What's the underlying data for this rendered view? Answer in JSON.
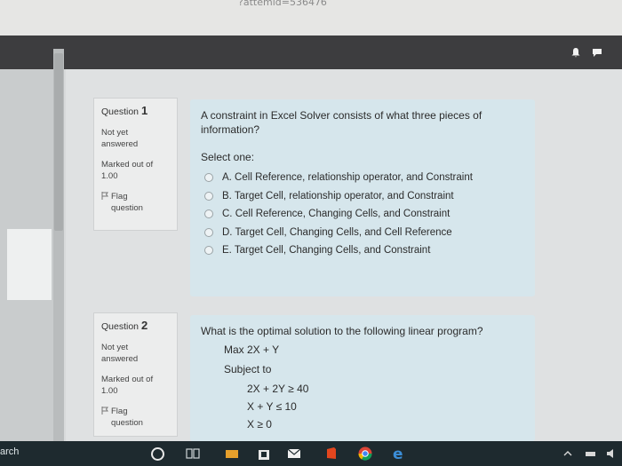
{
  "browser": {
    "url_fragment": "?attemid=536476"
  },
  "questions": [
    {
      "label": "Question",
      "number": "1",
      "status_line1": "Not yet",
      "status_line2": "answered",
      "marked_label": "Marked out of",
      "marked_value": "1.00",
      "flag_line1": "Flag",
      "flag_line2": "question",
      "prompt": "A constraint in Excel Solver consists of what three pieces of information?",
      "select_label": "Select one:",
      "options": [
        "A. Cell Reference, relationship operator, and Constraint",
        "B. Target Cell, relationship operator, and Constraint",
        "C. Cell Reference, Changing Cells, and Constraint",
        "D. Target Cell, Changing Cells, and Cell Reference",
        "E. Target Cell, Changing Cells, and Constraint"
      ]
    },
    {
      "label": "Question",
      "number": "2",
      "status_line1": "Not yet",
      "status_line2": "answered",
      "marked_label": "Marked out of",
      "marked_value": "1.00",
      "flag_line1": "Flag",
      "flag_line2": "question",
      "prompt": "What is the optimal solution to the following linear program?",
      "objective": "Max 2X + Y",
      "subject_to": "Subject to",
      "constraints": [
        "2X + 2Y ≥ 40",
        "X + Y ≤ 10",
        "X ≥ 0"
      ]
    }
  ],
  "taskbar": {
    "search_text": "arch"
  },
  "colors": {
    "navbar": "#3d3d3f",
    "question_text_bg": "#d6e6ec",
    "info_bg": "#eceded",
    "taskbar": "#1e2a2f"
  }
}
